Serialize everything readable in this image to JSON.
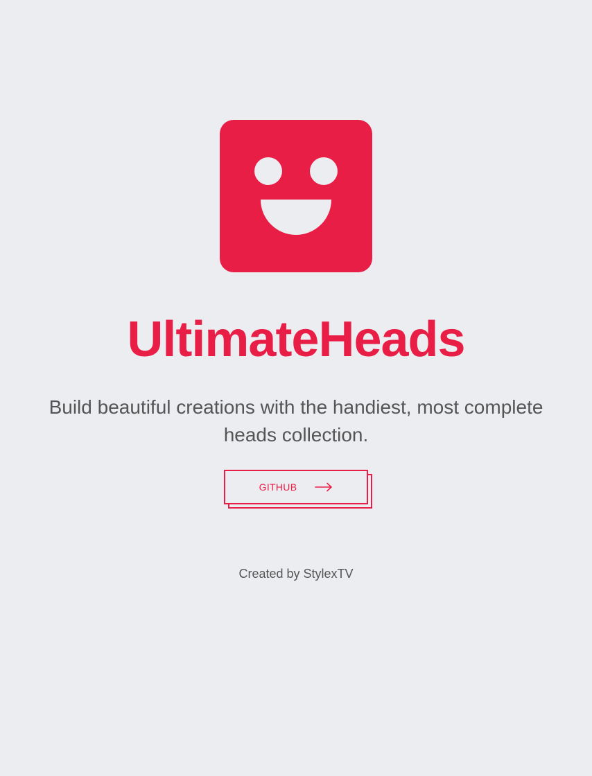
{
  "logo": {
    "icon": "smiley-face-icon",
    "color": "#e91e47"
  },
  "title": "UltimateHeads",
  "tagline": "Build beautiful creations with the handiest, most complete heads collection.",
  "github_button": {
    "label": "GITHUB",
    "icon": "arrow-right-icon"
  },
  "credit": "Created by StylexTV",
  "colors": {
    "accent": "#e91e47",
    "background": "#ecedf0",
    "text": "#555555"
  }
}
